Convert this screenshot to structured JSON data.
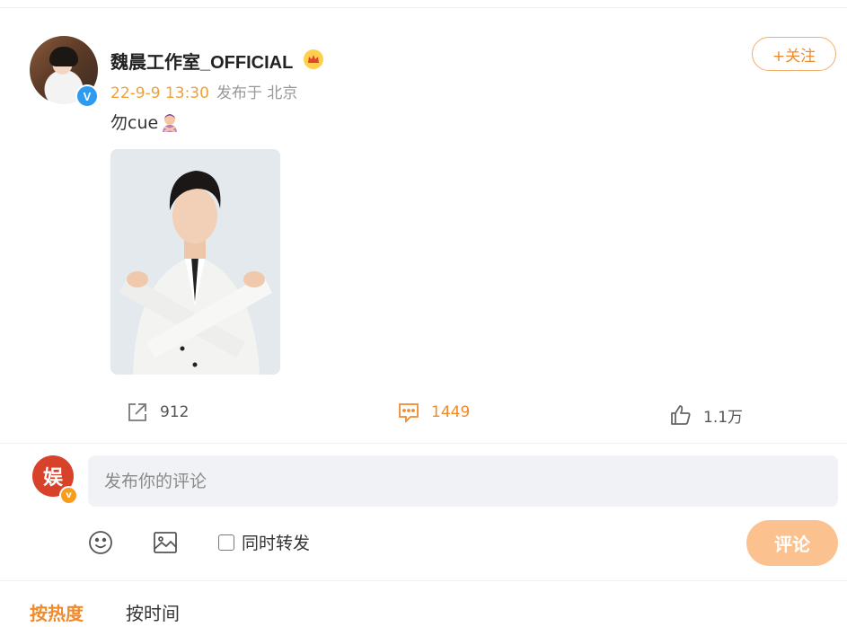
{
  "post": {
    "author": "魏晨工作室_OFFICIAL",
    "verified_icon": "verified-v-icon",
    "vip_icon": "crown-icon",
    "time": "22-9-9 13:30",
    "location": "发布于 北京",
    "follow_label": "+关注",
    "text": "勿cue",
    "text_emoji": "person-gesturing-no-emoji"
  },
  "actions": {
    "share_count": "912",
    "comment_count": "1449",
    "like_count": "1.1万"
  },
  "comment_box": {
    "avatar_text": "娱",
    "badge_text": "v",
    "placeholder": "发布你的评论",
    "repost_label": "同时转发",
    "submit_label": "评论"
  },
  "sort": {
    "hot_label": "按热度",
    "time_label": "按时间"
  },
  "colors": {
    "accent": "#f08a2b",
    "submit_bg": "#fbc290",
    "verified": "#2d9cf0"
  }
}
